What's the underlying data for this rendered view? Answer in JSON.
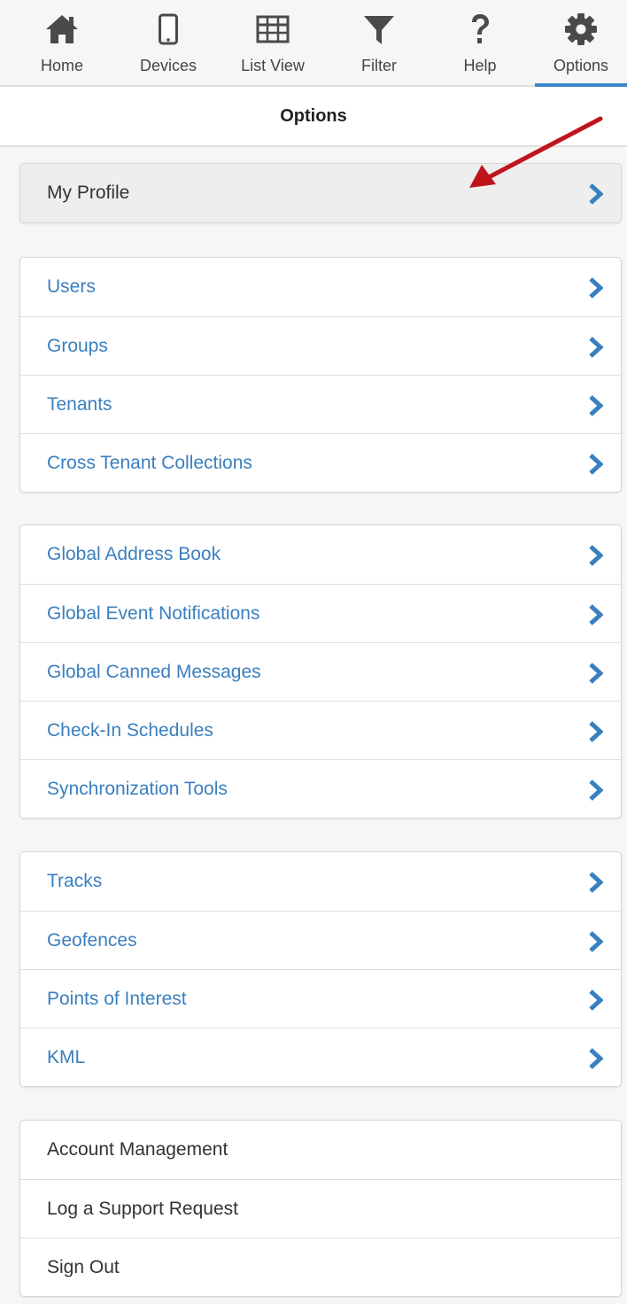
{
  "nav": {
    "items": [
      {
        "label": "Home",
        "icon": "home-icon"
      },
      {
        "label": "Devices",
        "icon": "phone-icon"
      },
      {
        "label": "List View",
        "icon": "table-icon"
      },
      {
        "label": "Filter",
        "icon": "filter-icon"
      },
      {
        "label": "Help",
        "icon": "question-icon"
      },
      {
        "label": "Options",
        "icon": "gear-icon"
      }
    ],
    "active": "Options"
  },
  "title": "Options",
  "profile": {
    "label": "My Profile"
  },
  "admin_group": [
    "Users",
    "Groups",
    "Tenants",
    "Cross Tenant Collections"
  ],
  "global_group": [
    "Global Address Book",
    "Global Event Notifications",
    "Global Canned Messages",
    "Check-In Schedules",
    "Synchronization Tools"
  ],
  "map_group": [
    "Tracks",
    "Geofences",
    "Points of Interest",
    "KML"
  ],
  "account_group": [
    "Account Management",
    "Log a Support Request",
    "Sign Out"
  ],
  "colors": {
    "accent": "#3a87c9",
    "link": "#3a7fbf",
    "icon": "#4a4a4a",
    "annotation_arrow": "#c0141b"
  }
}
